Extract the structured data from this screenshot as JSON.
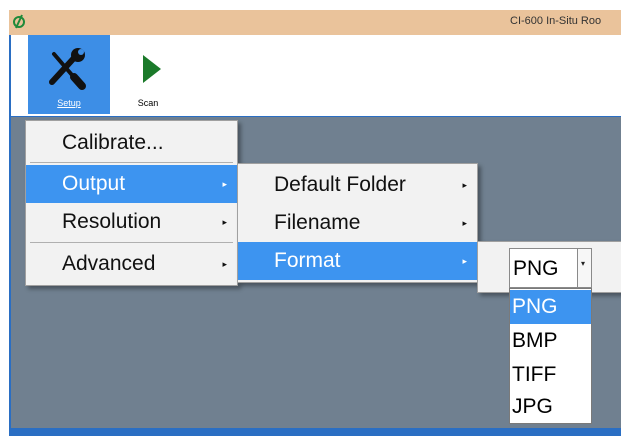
{
  "window": {
    "title": "CI-600 In-Situ Roo"
  },
  "ribbon": {
    "setup": {
      "label": "Setup",
      "icon": "tools-icon"
    },
    "scan": {
      "label": "Scan",
      "icon": "play-icon"
    }
  },
  "menu": {
    "items": [
      {
        "label": "Calibrate..."
      },
      {
        "label": "Output",
        "arrow": "▸"
      },
      {
        "label": "Resolution",
        "arrow": "▸"
      },
      {
        "label": "Advanced",
        "arrow": "▸"
      }
    ]
  },
  "output_submenu": {
    "items": [
      {
        "label": "Default Folder",
        "arrow": "▸"
      },
      {
        "label": "Filename",
        "arrow": "▸"
      },
      {
        "label": "Format",
        "arrow": "▸"
      }
    ]
  },
  "format": {
    "value": "PNG",
    "options": [
      "PNG",
      "BMP",
      "TIFF",
      "JPG"
    ],
    "dropdown_arrow": "▾"
  },
  "colors": {
    "highlight": "#3d94f0",
    "titlebar": "#eac39b",
    "workspace": "#708090",
    "frame": "#2a6ec3"
  }
}
